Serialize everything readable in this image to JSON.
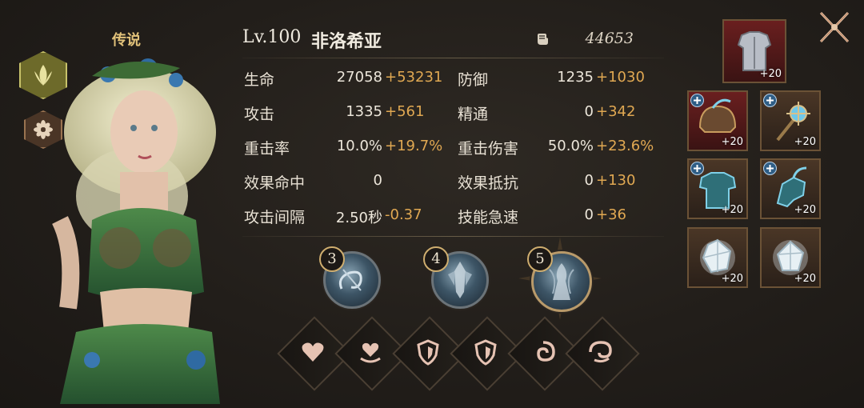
{
  "rarity": "传说",
  "hero": {
    "level": "Lv.100",
    "name": "非洛希亚",
    "power": "44653"
  },
  "stats": [
    {
      "label": "生命",
      "base": "27058",
      "bonus": "+53231"
    },
    {
      "label": "防御",
      "base": "1235",
      "bonus": "+1030"
    },
    {
      "label": "攻击",
      "base": "1335",
      "bonus": "+561"
    },
    {
      "label": "精通",
      "base": "0",
      "bonus": "+342"
    },
    {
      "label": "重击率",
      "base": "10.0%",
      "bonus": "+19.7%"
    },
    {
      "label": "重击伤害",
      "base": "50.0%",
      "bonus": "+23.6%"
    },
    {
      "label": "效果命中",
      "base": "0",
      "bonus": ""
    },
    {
      "label": "效果抵抗",
      "base": "0",
      "bonus": "+130"
    },
    {
      "label": "攻击间隔",
      "base": "2.50秒",
      "bonus": "-0.37"
    },
    {
      "label": "技能急速",
      "base": "0",
      "bonus": "+36"
    }
  ],
  "skills": [
    {
      "number": "3",
      "icon": "swirl-skill-icon"
    },
    {
      "number": "4",
      "icon": "armored-figure-skill-icon"
    },
    {
      "number": "5",
      "icon": "dryad-figure-skill-icon"
    }
  ],
  "slots": [
    {
      "icon": "heart-icon"
    },
    {
      "icon": "heart-hand-icon"
    },
    {
      "icon": "shield-icon"
    },
    {
      "icon": "shield-icon"
    },
    {
      "icon": "swirl-icon"
    },
    {
      "icon": "swirl-icon"
    }
  ],
  "equipment": [
    {
      "icon": "chest-armor-icon",
      "level": "+20"
    },
    {
      "icon": "helmet-icon",
      "level": "+20",
      "upgrade": true
    },
    {
      "icon": "staff-icon",
      "level": "+20",
      "upgrade": true
    },
    {
      "icon": "chest-armor-icon",
      "level": "+20",
      "upgrade": true
    },
    {
      "icon": "gauntlet-icon",
      "level": "+20",
      "upgrade": true
    },
    {
      "icon": "crystal-icon",
      "level": "+20"
    },
    {
      "icon": "crystal-icon",
      "level": "+20"
    }
  ],
  "colors": {
    "bonus": "#e0a852",
    "rarity": "#e2c27a",
    "frame": "#6b5236",
    "red_slot": "#6a1f1f"
  }
}
